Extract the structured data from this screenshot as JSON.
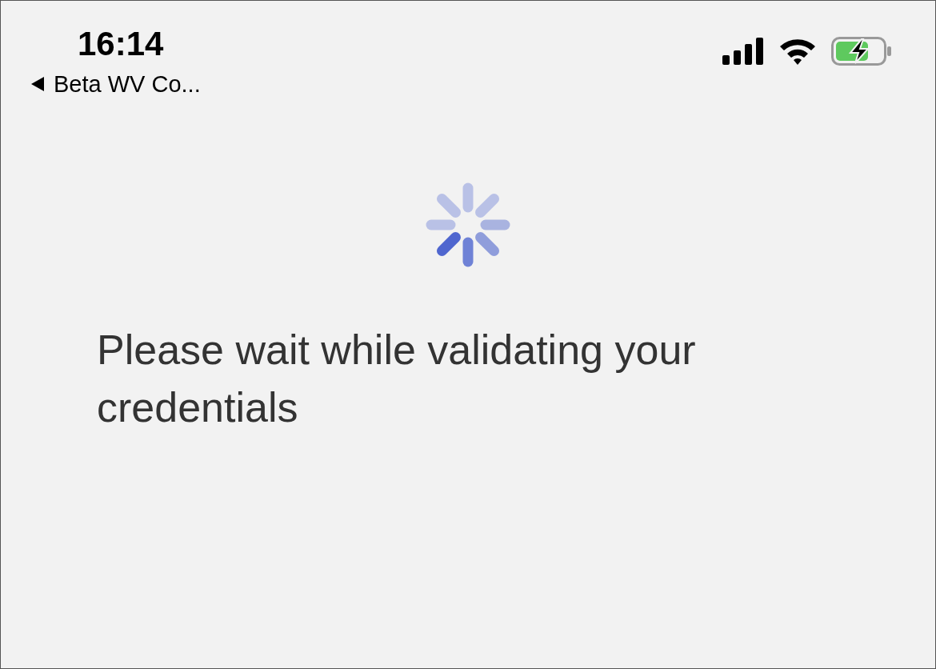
{
  "status_bar": {
    "time": "16:14",
    "back_link": "Beta WV Co..."
  },
  "message": "Please wait while validating your credentials"
}
